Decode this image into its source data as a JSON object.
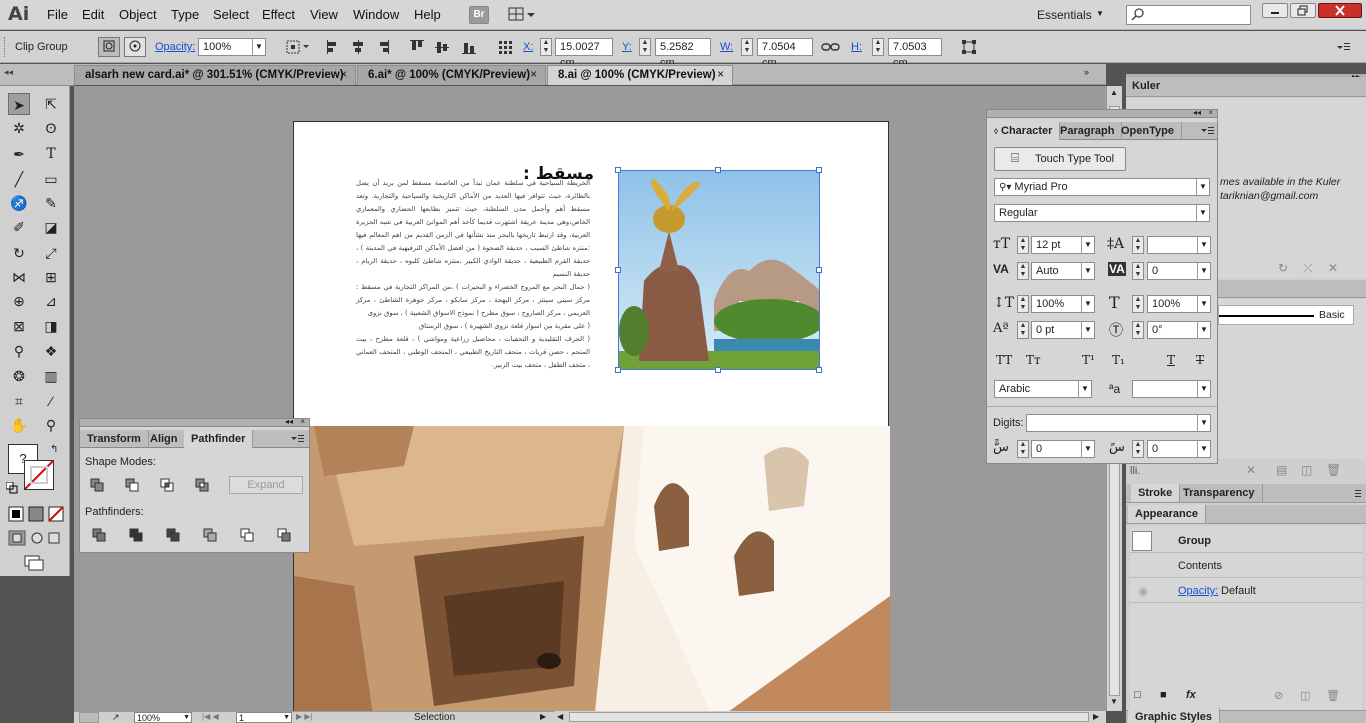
{
  "app": {
    "logo": "Ai"
  },
  "menu": [
    "File",
    "Edit",
    "Object",
    "Type",
    "Select",
    "Effect",
    "View",
    "Window",
    "Help"
  ],
  "bridge_label": "Br",
  "workspace": "Essentials",
  "control": {
    "selection_label": "Clip Group",
    "opacity_label": "Opacity:",
    "opacity_value": "100%",
    "x_label": "X:",
    "x_value": "15.0027 cm",
    "y_label": "Y:",
    "y_value": "5.2582 cm",
    "w_label": "W:",
    "w_value": "7.0504 cm",
    "h_label": "H:",
    "h_value": "7.0503 cm"
  },
  "tabs": [
    {
      "label": "alsarh new card.ai* @ 301.51% (CMYK/Preview)"
    },
    {
      "label": "6.ai* @ 100% (CMYK/Preview)"
    },
    {
      "label": "8.ai @ 100% (CMYK/Preview)"
    }
  ],
  "artboard": {
    "heading": "مسقط :",
    "paragraphs": [
      "الخريطة السياحية في سلطنة عمان تبدأ من العاصمة مسقط لمن يريد أن يصل بالطائرة، حيث تتوافر فيها العديد من الأماكن التاريخية والسياحية والتجارية. وتعد مسقط أهم وأجمل مدن السلطنة، حيث تتميز بطابعها الحضاري والمعماري الخاص،وهي مدينة عريقة اشتهرت قديما كأحد أهم الموانئ العربية في شبه الجزيرة العربية، وقد ارتبط تاريخها بالبحر منذ نشأتها في الزمن القديم من اهم المعالم فيها :منتزه شاطئ السيب ، حديقة الصحوة ( من افضل الأماكن الترفيهية في المدينة ) ، حديقة القرم الطبيعية ، حديقة الوادي الكبير ،منتزه شاطئ كلبوه ، حديقة الريام ، حديقة النسيم",
      "( جمال البحر مع المروج الخضراء و البحيرات ) ،من المراكز التجارية في مسقط : مركز سيتي سينتر ، مركز البهجة ، مركز سابكو ، مركز جوهرة الشاطئ ، مركز العريمي ، مركز الصاروج ، سوق مطرح ( نموذج الاسواق الشعبية ) ، سوق نزوى",
      "( على مقربة من اسوار قلعة نزوى الشهيرة ) ، سوق الرستاق",
      "( الحرف التقليدية و التحفيات ، محاصيل زراعية ومواشي ) ، قلعة مطرح ، بيت المتحم ، حصن قريات ، متحف التاريخ الطبيعي ، المتحف الوطني ، المتحف العماني ، متحف الطفل ، متحف بيت الزبير."
    ]
  },
  "pathfinder": {
    "tabs": [
      "Transform",
      "Align",
      "Pathfinder"
    ],
    "shape_modes_label": "Shape Modes:",
    "expand_label": "Expand",
    "pathfinders_label": "Pathfinders:"
  },
  "character": {
    "tabs": [
      "Character",
      "Paragraph",
      "OpenType"
    ],
    "touch_type_label": "Touch Type Tool",
    "font_family": "Myriad Pro",
    "font_style": "Regular",
    "font_size": "12 pt",
    "leading": "",
    "kerning": "Auto",
    "tracking": "0",
    "vertical_scale": "100%",
    "horizontal_scale": "100%",
    "baseline_shift": "0 pt",
    "rotation": "0°",
    "language": "Arabic",
    "antialias": "",
    "digits_label": "Digits:",
    "digits_value": "",
    "diacritic_x": "0",
    "diacritic_y": "0"
  },
  "kuler": {
    "title": "Kuler",
    "line1": "mes available in the Kuler",
    "line2": "tariknian@gmail.com"
  },
  "stroke_panel": {
    "basic_label": "Basic"
  },
  "lower_tabs": [
    "Stroke",
    "Transparency"
  ],
  "appearance": {
    "title": "Appearance",
    "group_label": "Group",
    "contents_label": "Contents",
    "opacity_label": "Opacity:",
    "opacity_value": "Default"
  },
  "graphic_styles": "Graphic Styles",
  "status": {
    "zoom": "100%",
    "page": "1",
    "tool": "Selection"
  }
}
